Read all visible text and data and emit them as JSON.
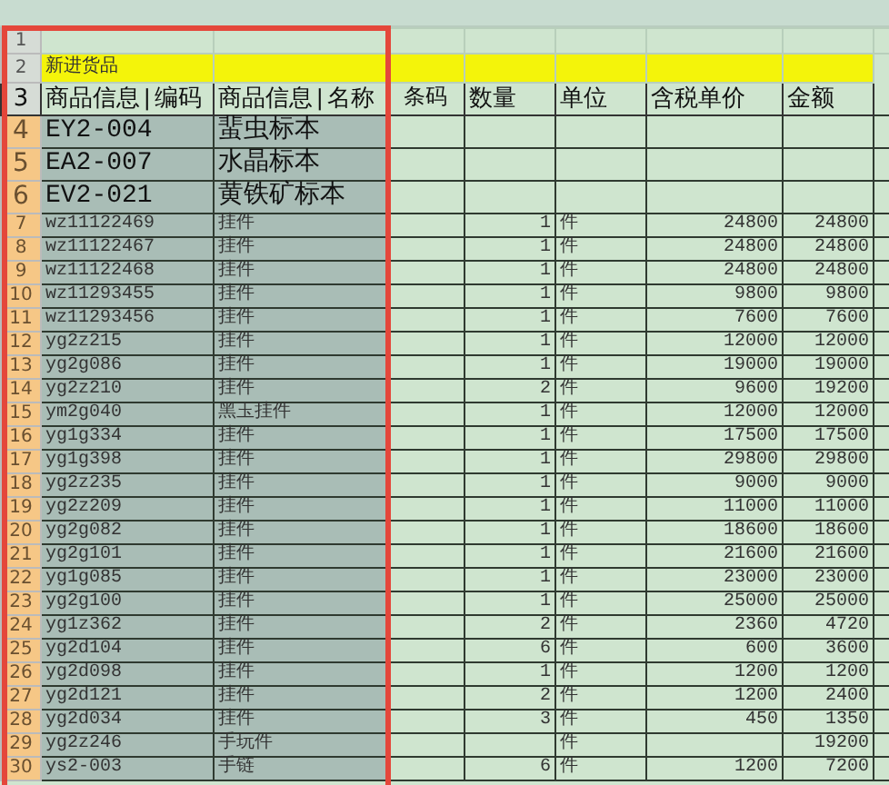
{
  "sheet": {
    "rows": [
      {
        "number": "1",
        "selected": false,
        "cells": []
      },
      {
        "number": "2",
        "selected": false,
        "kind": "band",
        "cells": [
          "新进货品"
        ]
      },
      {
        "number": "3",
        "selected": false,
        "kind": "header",
        "cells": [
          "商品信息|编码",
          "商品信息|名称",
          "条码",
          "数量",
          "单位",
          "含税单价",
          "金额"
        ]
      },
      {
        "number": "4",
        "selected": true,
        "kind": "large",
        "cells": [
          "EY2-004",
          "蜚虫标本"
        ]
      },
      {
        "number": "5",
        "selected": true,
        "kind": "large",
        "cells": [
          "EA2-007",
          "水晶标本"
        ]
      },
      {
        "number": "6",
        "selected": true,
        "kind": "large",
        "cells": [
          "EV2-021",
          "黄铁矿标本"
        ]
      },
      {
        "number": "7",
        "selected": true,
        "cells": [
          "wz11122469",
          "挂件",
          "",
          "1",
          "件",
          "24800",
          "24800"
        ]
      },
      {
        "number": "8",
        "selected": true,
        "cells": [
          "wz11122467",
          "挂件",
          "",
          "1",
          "件",
          "24800",
          "24800"
        ]
      },
      {
        "number": "9",
        "selected": true,
        "cells": [
          "wz11122468",
          "挂件",
          "",
          "1",
          "件",
          "24800",
          "24800"
        ]
      },
      {
        "number": "10",
        "selected": true,
        "cells": [
          "wz11293455",
          "挂件",
          "",
          "1",
          "件",
          "9800",
          "9800"
        ]
      },
      {
        "number": "11",
        "selected": true,
        "cells": [
          "wz11293456",
          "挂件",
          "",
          "1",
          "件",
          "7600",
          "7600"
        ]
      },
      {
        "number": "12",
        "selected": true,
        "cells": [
          "yg2z215",
          "挂件",
          "",
          "1",
          "件",
          "12000",
          "12000"
        ]
      },
      {
        "number": "13",
        "selected": true,
        "cells": [
          "yg2g086",
          "挂件",
          "",
          "1",
          "件",
          "19000",
          "19000"
        ]
      },
      {
        "number": "14",
        "selected": true,
        "cells": [
          "yg2z210",
          "挂件",
          "",
          "2",
          "件",
          "9600",
          "19200"
        ]
      },
      {
        "number": "15",
        "selected": true,
        "cells": [
          "ym2g040",
          "黑玉挂件",
          "",
          "1",
          "件",
          "12000",
          "12000"
        ]
      },
      {
        "number": "16",
        "selected": true,
        "cells": [
          "yg1g334",
          "挂件",
          "",
          "1",
          "件",
          "17500",
          "17500"
        ]
      },
      {
        "number": "17",
        "selected": true,
        "cells": [
          "yg1g398",
          "挂件",
          "",
          "1",
          "件",
          "29800",
          "29800"
        ]
      },
      {
        "number": "18",
        "selected": true,
        "cells": [
          "yg2z235",
          "挂件",
          "",
          "1",
          "件",
          "9000",
          "9000"
        ]
      },
      {
        "number": "19",
        "selected": true,
        "cells": [
          "yg2z209",
          "挂件",
          "",
          "1",
          "件",
          "11000",
          "11000"
        ]
      },
      {
        "number": "20",
        "selected": true,
        "cells": [
          "yg2g082",
          "挂件",
          "",
          "1",
          "件",
          "18600",
          "18600"
        ]
      },
      {
        "number": "21",
        "selected": true,
        "cells": [
          "yg2g101",
          "挂件",
          "",
          "1",
          "件",
          "21600",
          "21600"
        ]
      },
      {
        "number": "22",
        "selected": true,
        "cells": [
          "yg1g085",
          "挂件",
          "",
          "1",
          "件",
          "23000",
          "23000"
        ]
      },
      {
        "number": "23",
        "selected": true,
        "cells": [
          "yg2g100",
          "挂件",
          "",
          "1",
          "件",
          "25000",
          "25000"
        ]
      },
      {
        "number": "24",
        "selected": true,
        "cells": [
          "yg1z362",
          "挂件",
          "",
          "2",
          "件",
          "2360",
          "4720"
        ]
      },
      {
        "number": "25",
        "selected": true,
        "cells": [
          "yg2d104",
          "挂件",
          "",
          "6",
          "件",
          "600",
          "3600"
        ]
      },
      {
        "number": "26",
        "selected": true,
        "cells": [
          "yg2d098",
          "挂件",
          "",
          "1",
          "件",
          "1200",
          "1200"
        ]
      },
      {
        "number": "27",
        "selected": true,
        "cells": [
          "yg2d121",
          "挂件",
          "",
          "2",
          "件",
          "1200",
          "2400"
        ]
      },
      {
        "number": "28",
        "selected": true,
        "cells": [
          "yg2d034",
          "挂件",
          "",
          "3",
          "件",
          "450",
          "1350"
        ]
      },
      {
        "number": "29",
        "selected": true,
        "cells": [
          "yg2z246",
          "手玩件",
          "",
          "",
          "件",
          "",
          "19200"
        ]
      },
      {
        "number": "30",
        "selected": true,
        "cells": [
          "ys2-003",
          "手链",
          "",
          "6",
          "件",
          "1200",
          "7200"
        ]
      }
    ]
  }
}
